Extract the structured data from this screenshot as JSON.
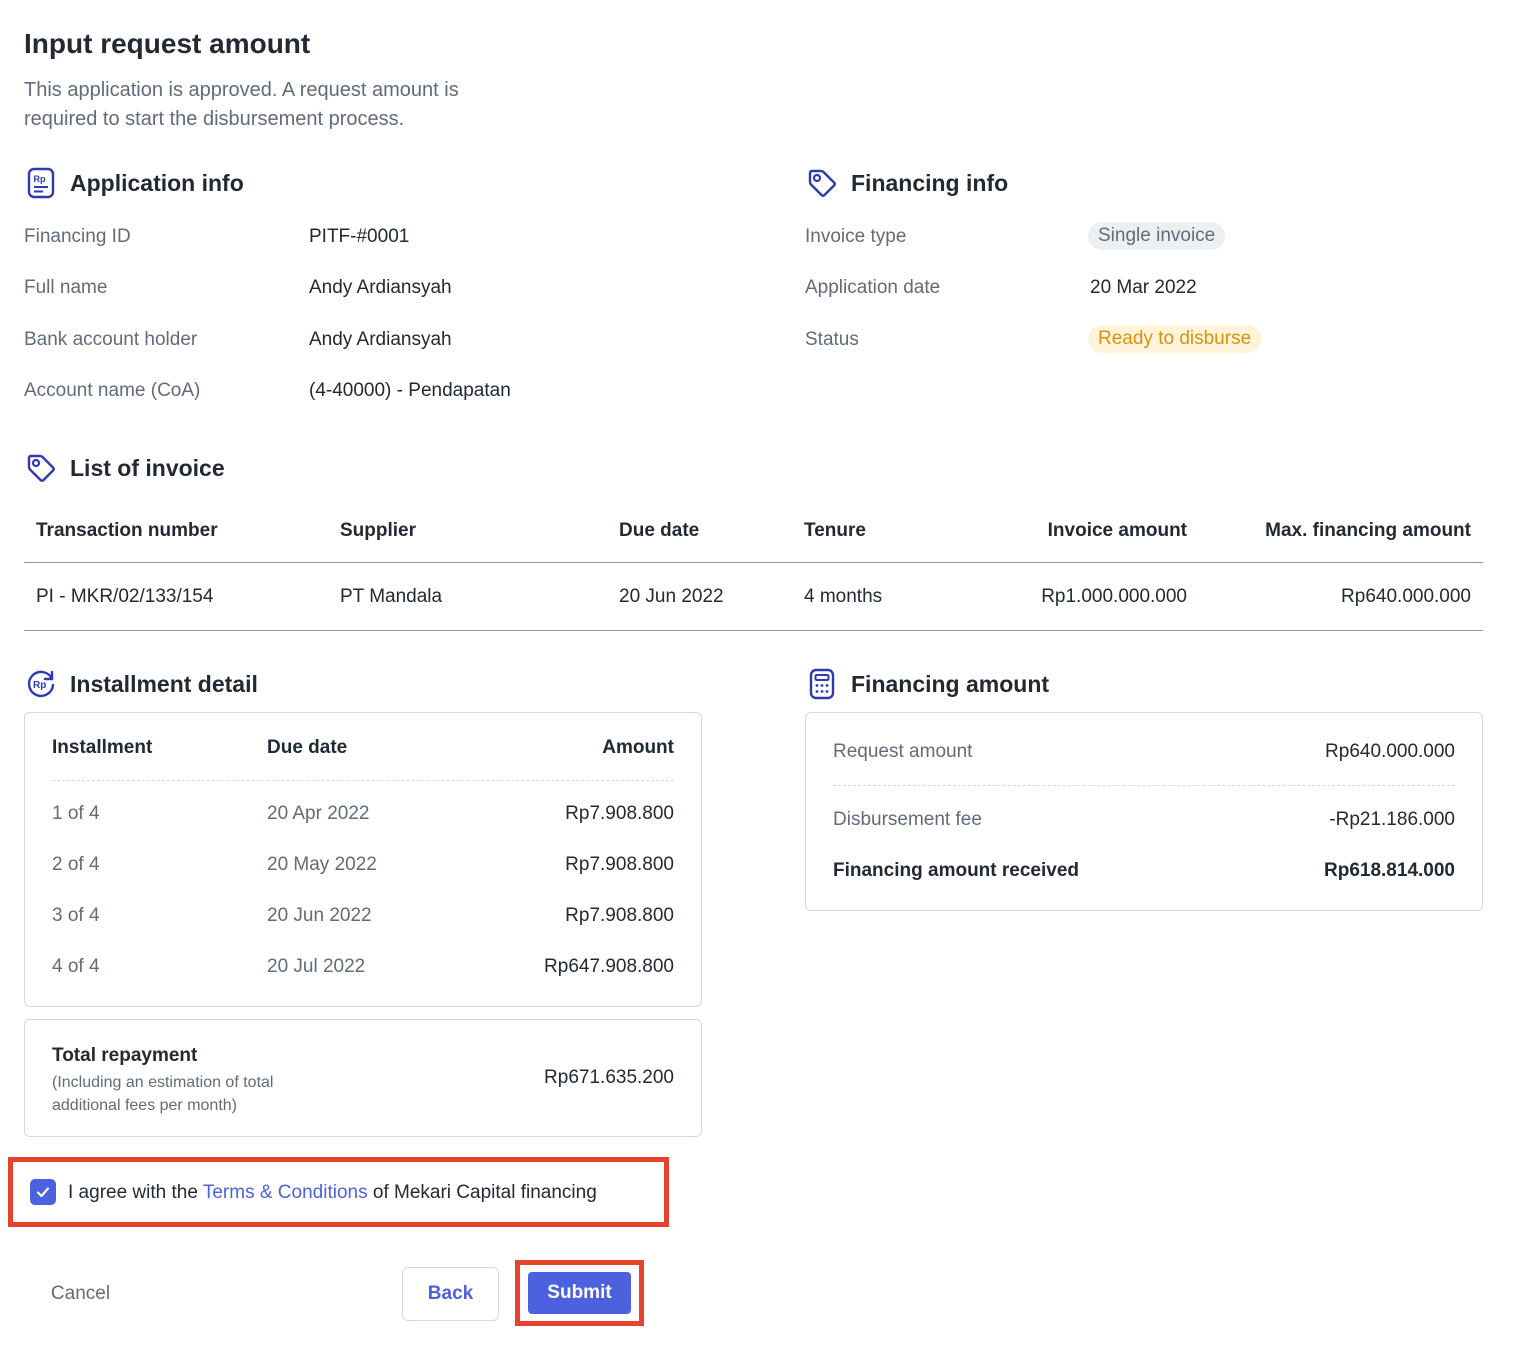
{
  "header": {
    "title": "Input request amount",
    "description": "This application is approved. A request amount is required to start the disbursement process."
  },
  "application_info": {
    "title": "Application info",
    "icon": "rp-document-icon",
    "rows": [
      {
        "label": "Financing ID",
        "value": "PITF-#0001"
      },
      {
        "label": "Full name",
        "value": "Andy Ardiansyah"
      },
      {
        "label": "Bank account holder",
        "value": "Andy Ardiansyah"
      },
      {
        "label": "Account name (CoA)",
        "value": "(4-40000) - Pendapatan"
      }
    ]
  },
  "financing_info": {
    "title": "Financing info",
    "icon": "tag-icon",
    "invoice_type_label": "Invoice type",
    "invoice_type_value": "Single invoice",
    "application_date_label": "Application date",
    "application_date_value": "20 Mar 2022",
    "status_label": "Status",
    "status_value": "Ready to disburse"
  },
  "invoice_list": {
    "title": "List of invoice",
    "icon": "tag-icon",
    "headers": [
      "Transaction number",
      "Supplier",
      "Due date",
      "Tenure",
      "Invoice amount",
      "Max. financing amount"
    ],
    "rows": [
      [
        "PI - MKR/02/133/154",
        "PT Mandala",
        "20 Jun 2022",
        "4 months",
        "Rp1.000.000.000",
        "Rp640.000.000"
      ]
    ]
  },
  "installment_detail": {
    "title": "Installment detail",
    "icon": "rp-refresh-icon",
    "headers": [
      "Installment",
      "Due date",
      "Amount"
    ],
    "rows": [
      [
        "1 of 4",
        "20 Apr 2022",
        "Rp7.908.800"
      ],
      [
        "2 of 4",
        "20 May 2022",
        "Rp7.908.800"
      ],
      [
        "3 of 4",
        "20 Jun 2022",
        "Rp7.908.800"
      ],
      [
        "4 of 4",
        "20 Jul 2022",
        "Rp647.908.800"
      ]
    ],
    "total_label": "Total repayment",
    "total_note": "(Including an estimation of total additional fees per month)",
    "total_value": "Rp671.635.200"
  },
  "financing_amount": {
    "title": "Financing amount",
    "icon": "calculator-icon",
    "request_label": "Request amount",
    "request_value": "Rp640.000.000",
    "fee_label": "Disbursement fee",
    "fee_value": "-Rp21.186.000",
    "received_label": "Financing amount received",
    "received_value": "Rp618.814.000"
  },
  "agreement": {
    "checked": true,
    "prefix": "I agree with the ",
    "link": "Terms & Conditions",
    "suffix": " of Mekari Capital financing"
  },
  "actions": {
    "cancel": "Cancel",
    "back": "Back",
    "submit": "Submit"
  },
  "colors": {
    "primary": "#4B61DD",
    "text": "#232933",
    "muted": "#626B79",
    "highlight": "#E5432E",
    "status_bg": "#FFF4DA",
    "status_text": "#D9920E"
  }
}
